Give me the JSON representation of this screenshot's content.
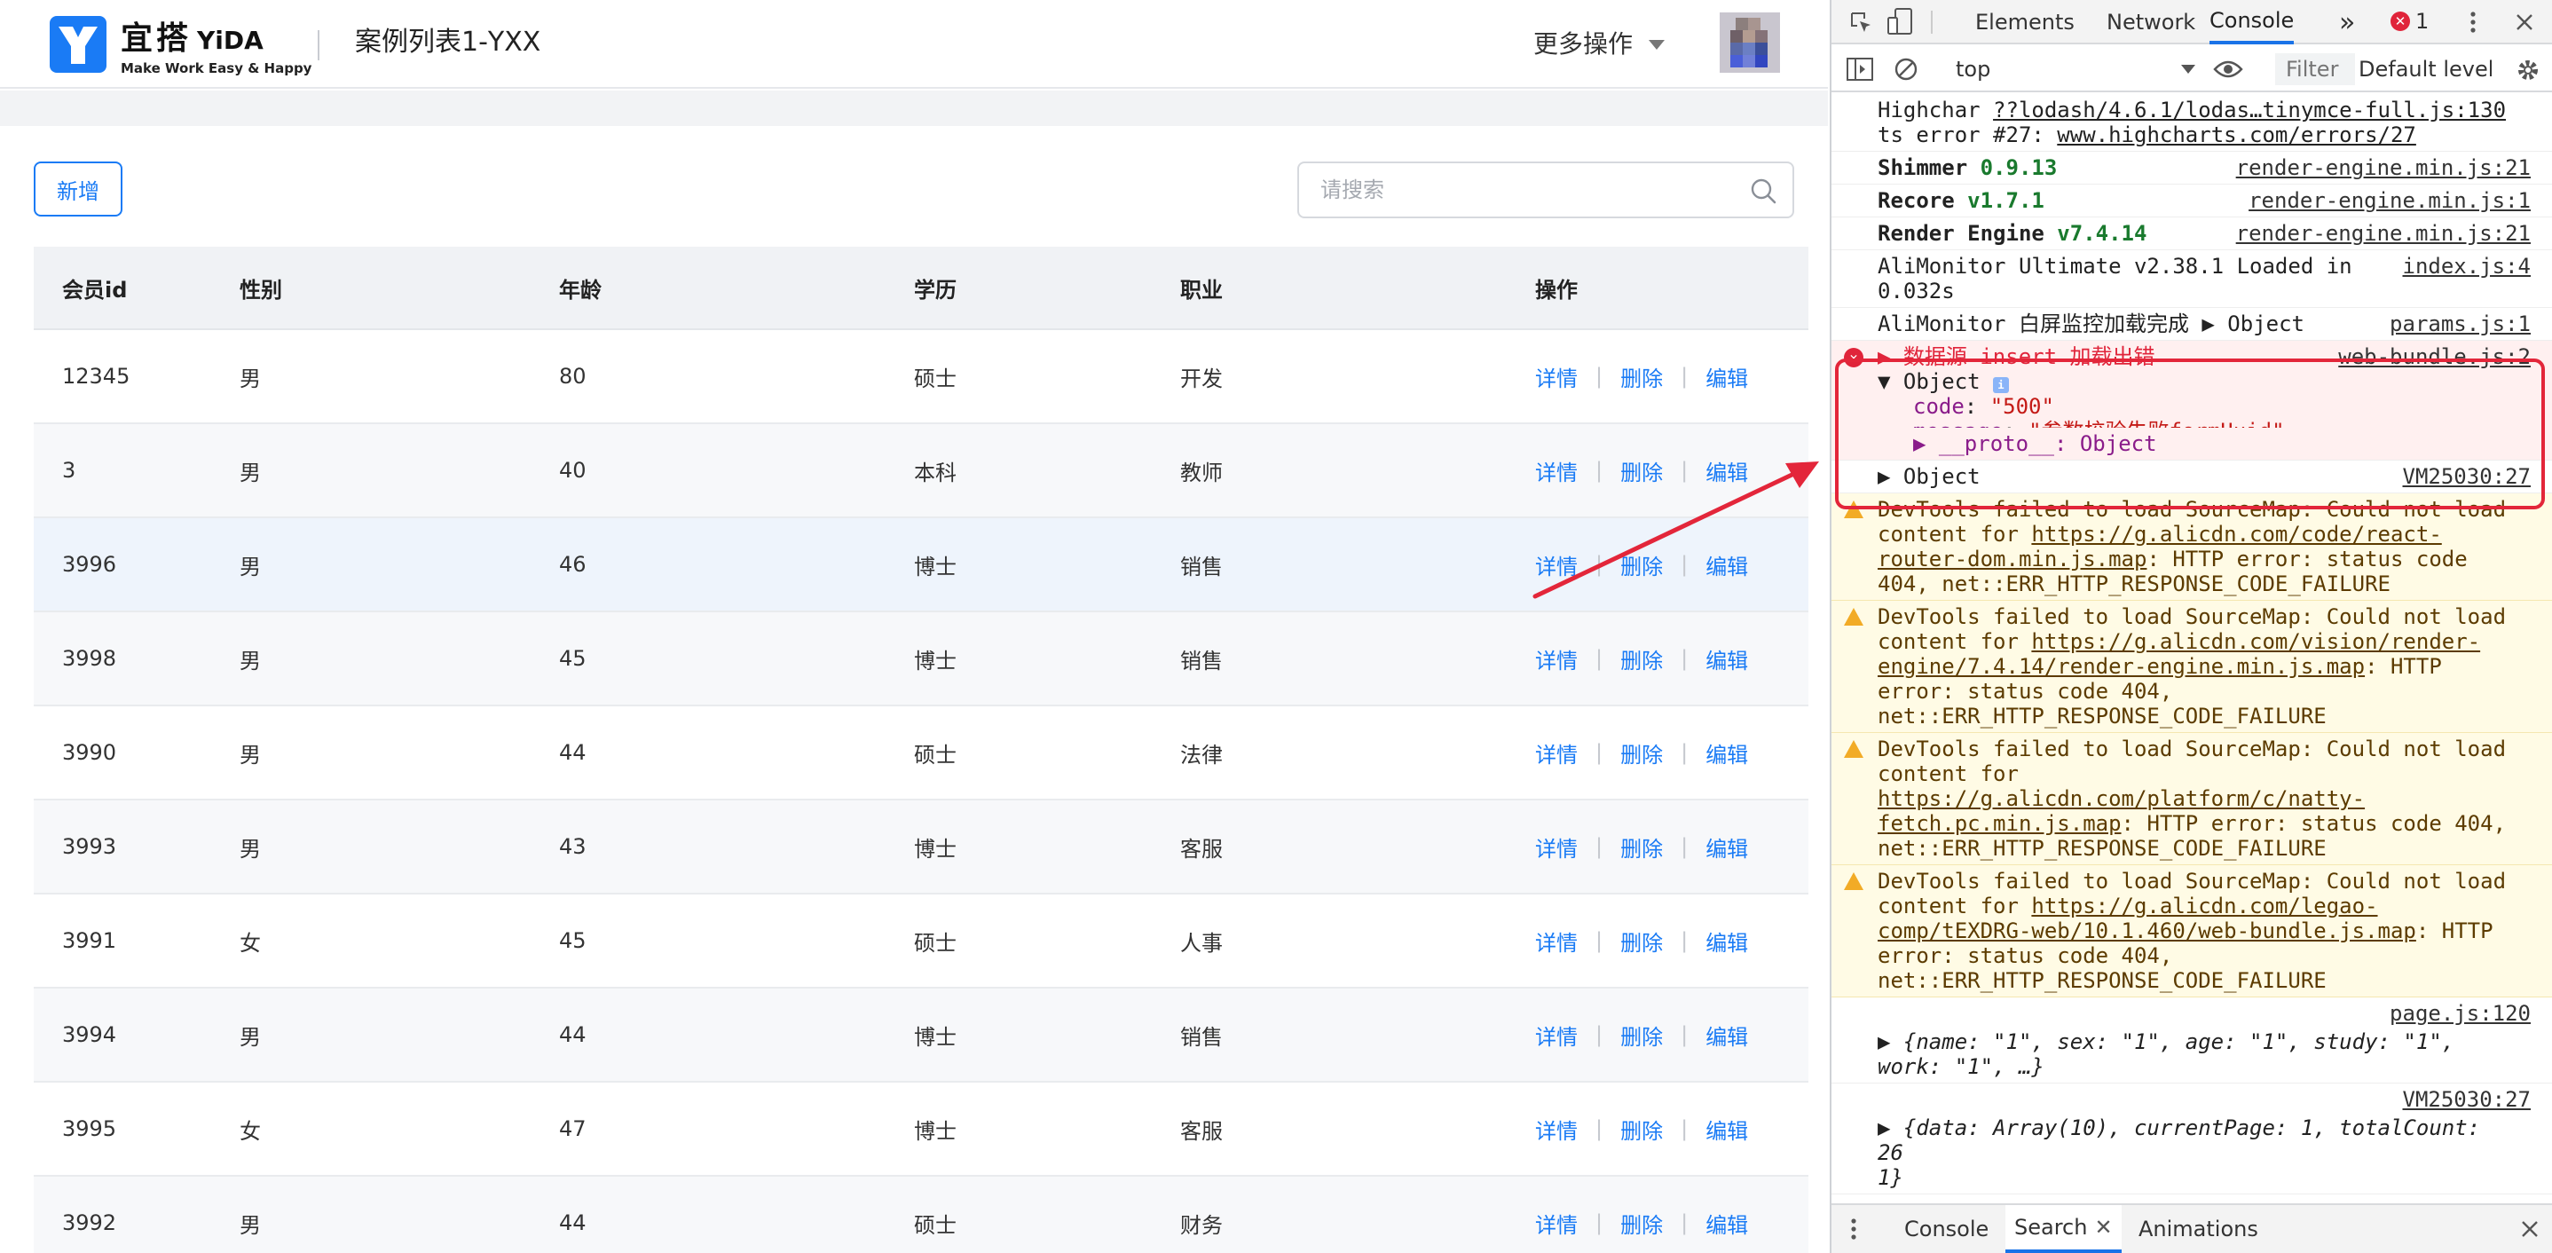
{
  "app": {
    "logo": {
      "cn": "宜搭",
      "en": "YiDA",
      "slogan": "Make Work Easy & Happy"
    },
    "title": "案例列表1-YXX",
    "more_actions": "更多操作",
    "add_button": "新增",
    "search_placeholder": "请搜索"
  },
  "table": {
    "headers": [
      "会员id",
      "性别",
      "年龄",
      "学历",
      "职业",
      "操作"
    ],
    "actions": [
      "详情",
      "删除",
      "编辑"
    ],
    "rows": [
      [
        "12345",
        "男",
        "80",
        "硕士",
        "开发"
      ],
      [
        "3",
        "男",
        "40",
        "本科",
        "教师"
      ],
      [
        "3996",
        "男",
        "46",
        "博士",
        "销售"
      ],
      [
        "3998",
        "男",
        "45",
        "博士",
        "销售"
      ],
      [
        "3990",
        "男",
        "44",
        "硕士",
        "法律"
      ],
      [
        "3993",
        "男",
        "43",
        "博士",
        "客服"
      ],
      [
        "3991",
        "女",
        "45",
        "硕士",
        "人事"
      ],
      [
        "3994",
        "男",
        "44",
        "博士",
        "销售"
      ],
      [
        "3995",
        "女",
        "47",
        "博士",
        "客服"
      ],
      [
        "3992",
        "男",
        "44",
        "硕士",
        "财务"
      ]
    ]
  },
  "devtools": {
    "tabs": [
      "Elements",
      "Network",
      "Console"
    ],
    "more": "»",
    "error_count": "1",
    "context": "top",
    "filter_placeholder": "Filter",
    "levels": "Default levels",
    "console": {
      "l1_a": "Highchar ",
      "l1_link": "??lodash/4.6.1/lodas…tinymce-full.js:130",
      "l1_b": "ts error #27: ",
      "l1_url": "www.highcharts.com/errors/27",
      "l2_name": "Shimmer ",
      "l2_ver": "0.9.13",
      "l2_src": "render-engine.min.js:21",
      "l3_name": "Recore ",
      "l3_ver": "v1.7.1",
      "l3_src": "render-engine.min.js:1",
      "l4_name": "Render Engine ",
      "l4_ver": "v7.4.14",
      "l4_src": "render-engine.min.js:21",
      "l5_text": "AliMonitor Ultimate v2.38.1 Loaded in 0.032s",
      "l5_src": "index.js:4",
      "l6_text": "AliMonitor 白屏监控加载完成 ",
      "l6_obj": "▶ Object",
      "l6_src": "params.js:1",
      "err_title": "▶ 数据源 insert 加载出错",
      "err_src": "web-bundle.js:2",
      "err_obj": "▼ Object",
      "err_code_key": "code",
      "err_code_val": "\"500\"",
      "err_msg_key": "message",
      "err_msg_val": "\"参数校验失败formUuid\"",
      "err_proto": "▶ __proto__: Object",
      "l7_text": "▶ Object",
      "l7_src": "VM25030:27",
      "w1_a": "DevTools failed to load SourceMap: Could not load content for ",
      "w1_link": "https://g.alicdn.com/code/react-router-dom.min.js.map",
      "w1_b": ": HTTP error: status code 404, net::ERR_HTTP_RESPONSE_CODE_FAILURE",
      "w2_a": "DevTools failed to load SourceMap: Could not load content for ",
      "w2_link": "https://g.alicdn.com/vision/render-engine/7.4.14/render-engine.min.js.map",
      "w2_b": ": HTTP error: status code 404, net::ERR_HTTP_RESPONSE_CODE_FAILURE",
      "w3_a": "DevTools failed to load SourceMap: Could not load content for ",
      "w3_link": "https://g.alicdn.com/platform/c/natty-fetch.pc.min.js.map",
      "w3_b": ": HTTP error: status code 404, net::ERR_HTTP_RESPONSE_CODE_FAILURE",
      "w4_a": "DevTools failed to load SourceMap: Could not load content for ",
      "w4_link": "https://g.alicdn.com/legao-comp/tEXDRG-web/10.1.460/web-bundle.js.map",
      "w4_b": ": HTTP error: status code 404, net::ERR_HTTP_RESPONSE_CODE_FAILURE",
      "l8_src": "page.js:120",
      "l8_text": "▶ {name: \"1\", sex: \"1\", age: \"1\", study: \"1\", work: \"1\", …}",
      "l9_src": "VM25030:27",
      "l9_text": "▶ {data: Array(10), currentPage: 1, totalCount: 26",
      "l9_cont": "1}"
    },
    "drawer_tabs": [
      "Console",
      "Search",
      "Animations"
    ]
  }
}
